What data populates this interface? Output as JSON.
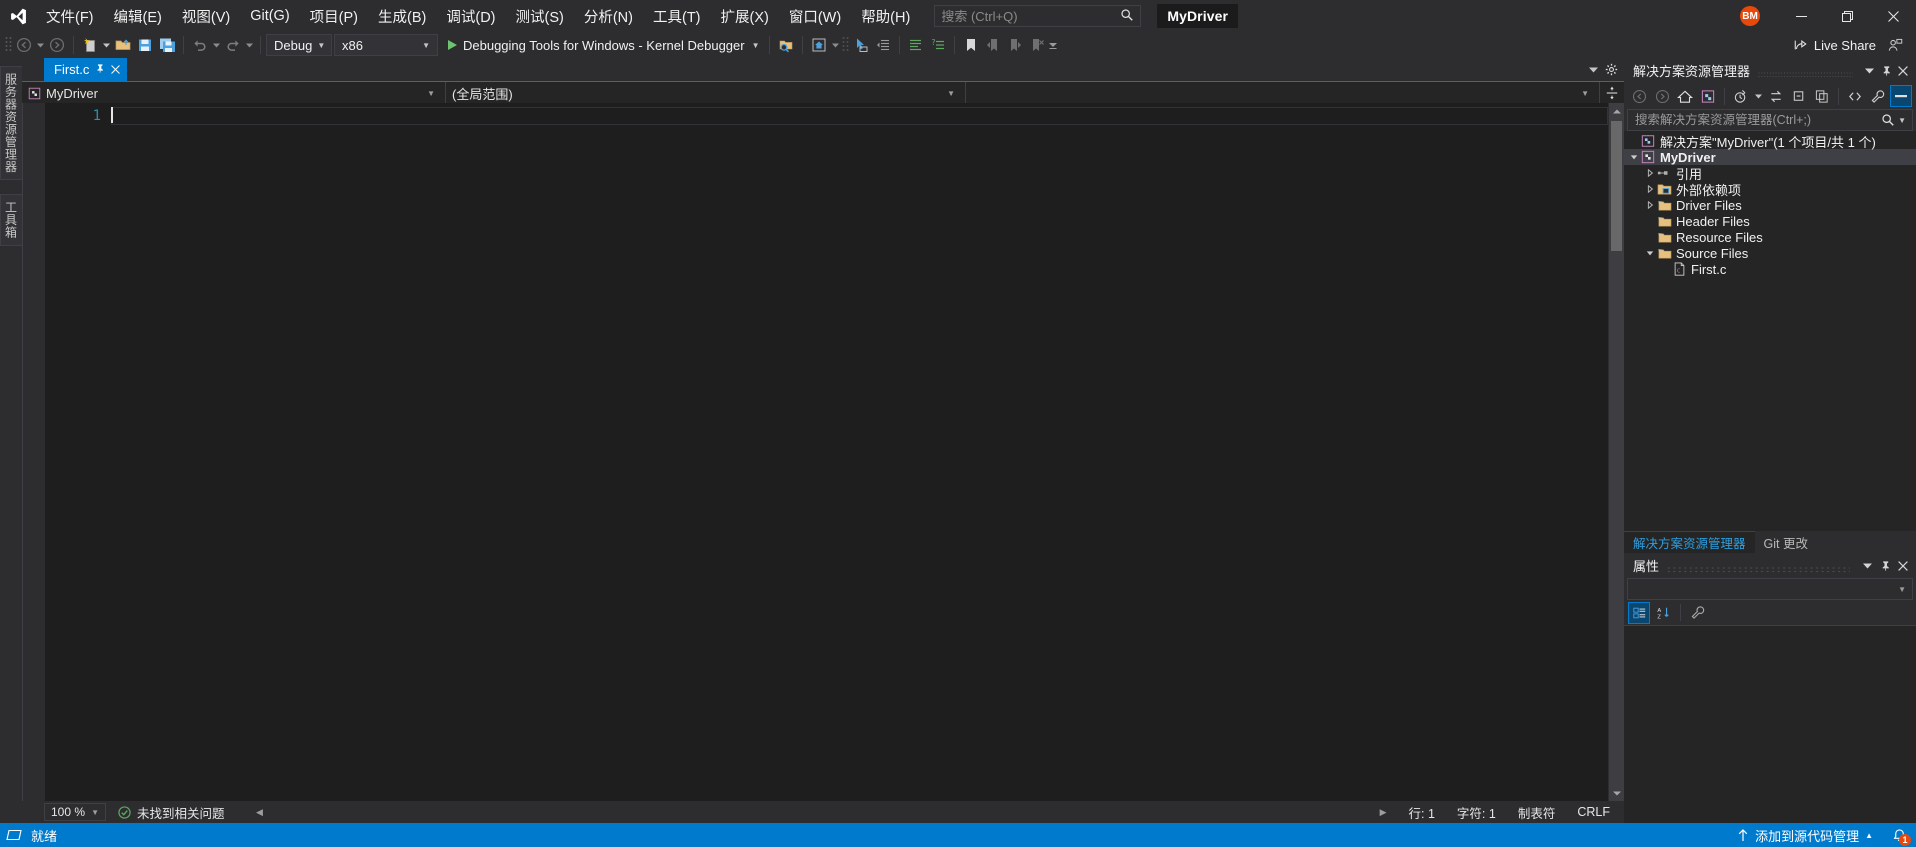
{
  "titlebar": {
    "logo_icon": "visual-studio-logo",
    "menus": [
      {
        "label": "文件(F)"
      },
      {
        "label": "编辑(E)"
      },
      {
        "label": "视图(V)"
      },
      {
        "label": "Git(G)"
      },
      {
        "label": "项目(P)"
      },
      {
        "label": "生成(B)"
      },
      {
        "label": "调试(D)"
      },
      {
        "label": "测试(S)"
      },
      {
        "label": "分析(N)"
      },
      {
        "label": "工具(T)"
      },
      {
        "label": "扩展(X)"
      },
      {
        "label": "窗口(W)"
      },
      {
        "label": "帮助(H)"
      }
    ],
    "search": {
      "value": "",
      "placeholder": "搜索 (Ctrl+Q)",
      "icon": "search-icon"
    },
    "project_title": "MyDriver",
    "account_initials": "BM",
    "account_color": "#e8490b",
    "minimize_label": "—",
    "maximize_label": "❐",
    "close_label": "✕"
  },
  "toolbar": {
    "nav_back_icon": "navigate-back-icon",
    "nav_forward_icon": "navigate-forward-icon",
    "new_item_icon": "new-item-icon",
    "open_file_icon": "open-file-icon",
    "save_icon": "save-icon",
    "save_all_icon": "save-all-icon",
    "undo_icon": "undo-icon",
    "redo_icon": "redo-icon",
    "config_combo": {
      "value": "Debug"
    },
    "platform_combo": {
      "value": "x86"
    },
    "start_debug": {
      "label": "Debugging Tools for Windows - Kernel Debugger",
      "icon": "play-icon"
    },
    "find_icon": "find-in-files-icon",
    "home_icon": "home-icon",
    "cursor_icon": "pointer-select-icon",
    "indent_icon": "indent-icon",
    "outdent_icon": "outdent-icon",
    "comment_icon": "comment-icon",
    "uncomment_icon": "uncomment-icon",
    "bookmark_icon": "bookmark-icon",
    "bookmark_prev_icon": "bookmark-prev-icon",
    "bookmark_next_icon": "bookmark-next-icon",
    "bookmark_clear_icon": "bookmark-clear-icon",
    "overflow_label": "»",
    "live_share": {
      "label": "Live Share",
      "icon": "live-share-icon"
    },
    "feedback_icon": "send-feedback-icon"
  },
  "left_dock": {
    "tabs": [
      {
        "label": "服务器资源管理器"
      },
      {
        "label": "工具箱"
      }
    ]
  },
  "editor": {
    "tab": {
      "label": "First.c",
      "pin_icon": "pin-icon",
      "close_icon": "close-icon"
    },
    "tab_menu_icon": "chevron-down-icon",
    "tab_config_icon": "gear-icon",
    "nav_project": {
      "value": "MyDriver",
      "icon": "project-icon"
    },
    "nav_scope": {
      "value": "(全局范围)"
    },
    "nav_member": {
      "value": ""
    },
    "split_icon": "split-window-icon",
    "lines": [
      {
        "num": "1",
        "text": ""
      }
    ],
    "status": {
      "zoom": "100 %",
      "issues": "未找到相关问题",
      "issues_icon": "check-circle-icon",
      "line": "行: 1",
      "char": "字符: 1",
      "tabs_mode": "制表符",
      "line_ending": "CRLF"
    }
  },
  "solution_explorer": {
    "title": "解决方案资源管理器",
    "header_buttons": [
      {
        "icon": "chevron-down-icon",
        "label": "▾"
      },
      {
        "icon": "pin-icon",
        "label": "⚑"
      },
      {
        "icon": "close-icon",
        "label": "✕"
      }
    ],
    "toolbar_icons": [
      "back-icon",
      "forward-icon",
      "home-icon",
      "solution-icon",
      "pending-changes-icon",
      "sync-icon",
      "collapse-all-icon",
      "copy-icon",
      "show-all-files-icon",
      "properties-icon",
      "preview-icon"
    ],
    "search": {
      "value": "",
      "placeholder": "搜索解决方案资源管理器(Ctrl+;)",
      "icon": "search-icon"
    },
    "tree": [
      {
        "label": "解决方案\"MyDriver\"(1 个项目/共 1 个)",
        "indent": 0,
        "twisty": "none",
        "icon": "solution-icon",
        "selected": false,
        "bold": false
      },
      {
        "label": "MyDriver",
        "indent": 1,
        "twisty": "expanded",
        "icon": "project-icon",
        "selected": true,
        "bold": true
      },
      {
        "label": "引用",
        "indent": 2,
        "twisty": "collapsed",
        "icon": "references-icon",
        "selected": false,
        "bold": false
      },
      {
        "label": "外部依赖项",
        "indent": 2,
        "twisty": "collapsed",
        "icon": "external-deps-icon",
        "selected": false,
        "bold": false
      },
      {
        "label": "Driver Files",
        "indent": 2,
        "twisty": "collapsed",
        "icon": "filter-folder-icon",
        "selected": false,
        "bold": false
      },
      {
        "label": "Header Files",
        "indent": 2,
        "twisty": "none",
        "icon": "filter-folder-icon",
        "selected": false,
        "bold": false
      },
      {
        "label": "Resource Files",
        "indent": 2,
        "twisty": "none",
        "icon": "filter-folder-icon",
        "selected": false,
        "bold": false
      },
      {
        "label": "Source Files",
        "indent": 2,
        "twisty": "expanded",
        "icon": "filter-folder-open-icon",
        "selected": false,
        "bold": false
      },
      {
        "label": "First.c",
        "indent": 3,
        "twisty": "none",
        "icon": "c-file-icon",
        "selected": false,
        "bold": false
      }
    ],
    "dock_tabs": [
      {
        "label": "解决方案资源管理器",
        "active": true
      },
      {
        "label": "Git 更改",
        "active": false
      }
    ]
  },
  "properties": {
    "title": "属性",
    "header_buttons": [
      {
        "icon": "chevron-down-icon",
        "label": "▾"
      },
      {
        "icon": "pin-icon",
        "label": "⚑"
      },
      {
        "icon": "close-icon",
        "label": "✕"
      }
    ],
    "selector_value": "",
    "toolbar_icons": [
      "categorized-icon",
      "alphabetical-icon",
      "property-pages-icon"
    ]
  },
  "statusbar": {
    "ready_label": "就绪",
    "ready_icon": "ready-icon",
    "source_control": {
      "label": "添加到源代码管理",
      "icon": "arrow-up-icon",
      "caret": "▲"
    },
    "notifications": {
      "icon": "bell-icon",
      "count": "1"
    }
  },
  "colors": {
    "accent": "#007acc",
    "titlebar_bg": "#2d2d30",
    "editor_bg": "#1e1e1e",
    "panel_bg": "#252526",
    "line_number": "#2b91af",
    "avatar": "#e8490b",
    "folder": "#e8c07d"
  }
}
